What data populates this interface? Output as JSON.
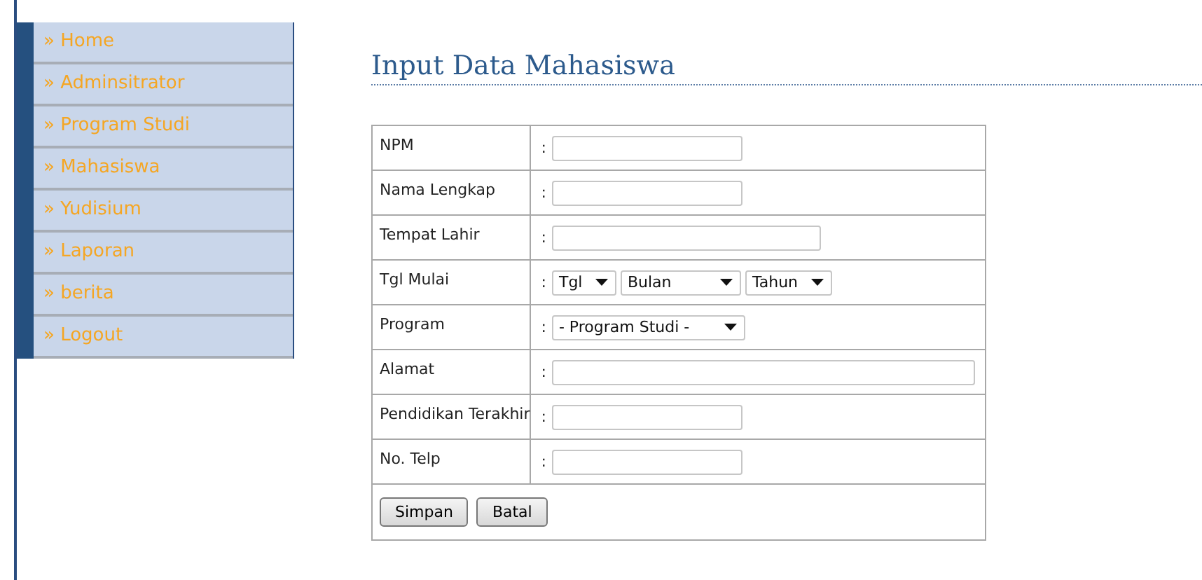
{
  "sidebar": {
    "items": [
      {
        "label": "» Home"
      },
      {
        "label": "» Adminsitrator"
      },
      {
        "label": "» Program Studi"
      },
      {
        "label": "» Mahasiswa"
      },
      {
        "label": "» Yudisium"
      },
      {
        "label": "» Laporan"
      },
      {
        "label": "» berita"
      },
      {
        "label": "» Logout"
      }
    ]
  },
  "title": "Input Data Mahasiswa",
  "form": {
    "rows": [
      {
        "label": "NPM",
        "separator": ":",
        "kind": "short"
      },
      {
        "label": "Nama Lengkap",
        "separator": ":",
        "kind": "short"
      },
      {
        "label": "Tempat Lahir",
        "separator": ":",
        "kind": "medium"
      },
      {
        "label": "Tgl Mulai",
        "separator": ":",
        "kind": "selects",
        "selects": [
          "Tgl",
          "Bulan",
          "Tahun"
        ]
      },
      {
        "label": "Program",
        "separator": ":",
        "kind": "selects",
        "selects": [
          "- Program Studi -"
        ]
      },
      {
        "label": "Alamat",
        "separator": ":",
        "kind": "long"
      },
      {
        "label": "Pendidikan Terakhir",
        "separator": ":",
        "kind": "short"
      },
      {
        "label": "No. Telp",
        "separator": ":",
        "kind": "short"
      }
    ],
    "buttons": [
      "Simpan",
      "Batal"
    ]
  }
}
